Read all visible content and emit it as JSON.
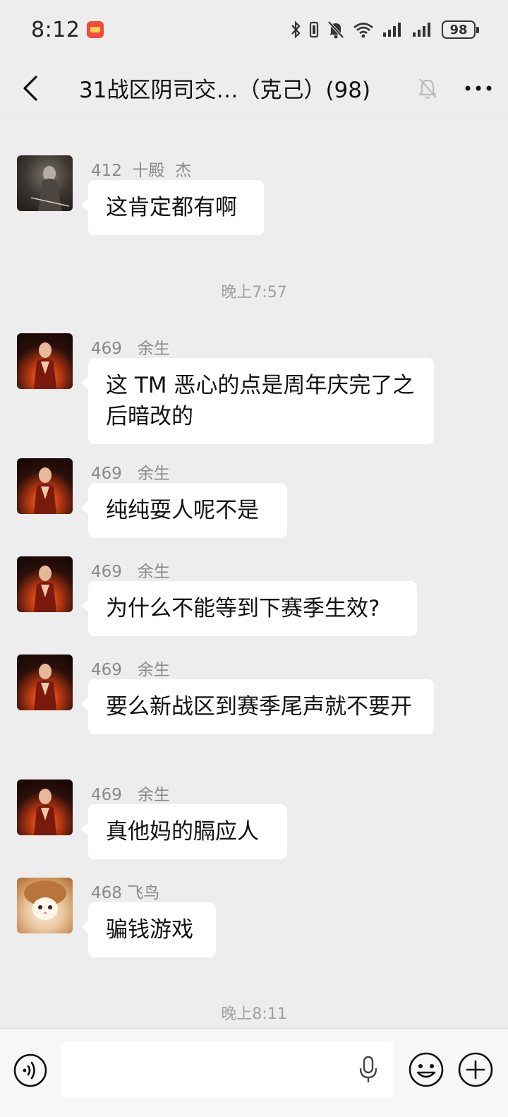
{
  "status_bar": {
    "time": "8:12",
    "battery": "98",
    "icons": [
      "bluetooth-icon",
      "vibrate-icon",
      "mute-icon",
      "wifi-icon",
      "signal-icon",
      "signal-icon"
    ]
  },
  "header": {
    "title": "31战区阴司交…（克己）(98)",
    "back_icon": "chevron-left-icon",
    "mute_icon": "bell-off-icon",
    "more_icon": "more-dots-icon"
  },
  "messages": [
    {
      "sender": "412  十殿  杰",
      "text": "这肯定都有啊"
    },
    {
      "sender": "469   余生",
      "text": "这 TM 恶心的点是周年庆完了之后暗改的"
    },
    {
      "sender": "469   余生",
      "text": "纯纯耍人呢不是"
    },
    {
      "sender": "469   余生",
      "text": "为什么不能等到下赛季生效?"
    },
    {
      "sender": "469   余生",
      "text": "要么新战区到赛季尾声就不要开"
    },
    {
      "sender": "469   余生",
      "text": "真他妈的膈应人"
    },
    {
      "sender": "468 飞鸟",
      "text": "骗钱游戏"
    }
  ],
  "timestamps": [
    "晚上7:57",
    "晚上8:11"
  ],
  "input_bar": {
    "placeholder": "",
    "icons": [
      "voice-icon",
      "mic-icon",
      "emoji-icon",
      "plus-icon"
    ]
  },
  "colors": {
    "background": "#ededed",
    "bubble": "#ffffff",
    "sender_text": "#8a8a8a"
  }
}
